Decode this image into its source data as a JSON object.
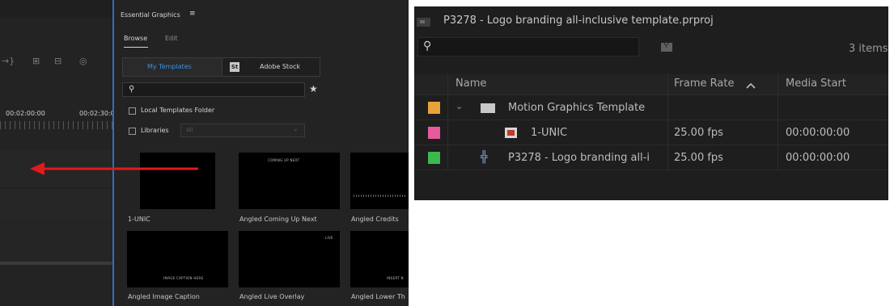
{
  "left": {
    "timeline": {
      "timecodes": [
        "00:02:00:00",
        "00:02:30:0"
      ],
      "icons": [
        "snap-icon",
        "link-icon",
        "marker-icon",
        "camera-icon"
      ]
    },
    "essential_graphics": {
      "title": "Essential Graphics",
      "menu_glyph": "≡",
      "tabs": [
        "Browse",
        "Edit"
      ],
      "source_buttons": {
        "my_templates": "My Templates",
        "stock_badge": "St",
        "adobe_stock": "Adobe Stock"
      },
      "search_placeholder": "",
      "star_glyph": "★",
      "checkboxes": {
        "local": "Local Templates Folder",
        "libraries": "Libraries"
      },
      "libraries_select": "All",
      "templates": [
        {
          "label": "1-UNIC",
          "mini": ""
        },
        {
          "label": "Angled Coming Up Next",
          "mini": "COMING UP NEXT"
        },
        {
          "label": "Angled Credits",
          "mini": ""
        },
        {
          "label": "Angled Image Caption",
          "mini": "IMAGE CAPTION HERE"
        },
        {
          "label": "Angled Live Overlay",
          "mini": "LIVE"
        },
        {
          "label": "Angled Lower Th",
          "mini": "INSERT N"
        }
      ]
    },
    "arrow_color": "#e01b1b",
    "accent": "#2f6fbd"
  },
  "project": {
    "title": "P3278 - Logo branding all-inclusive template.prproj",
    "item_count": "3 items",
    "columns": {
      "name": "Name",
      "frame_rate": "Frame Rate",
      "media_start": "Media Start"
    },
    "sort_glyph": "^",
    "rows": [
      {
        "color": "#e8a23a",
        "name": "Motion Graphics Template",
        "type": "folder",
        "frame_rate": "",
        "media_start": ""
      },
      {
        "color": "#e75a9c",
        "name": "1-UNIC",
        "type": "mogrt",
        "frame_rate": "25.00 fps",
        "media_start": "00:00:00:00"
      },
      {
        "color": "#3cb94c",
        "name": "P3278 - Logo branding all-i",
        "type": "sequence",
        "frame_rate": "25.00 fps",
        "media_start": "00:00:00:00"
      }
    ]
  }
}
